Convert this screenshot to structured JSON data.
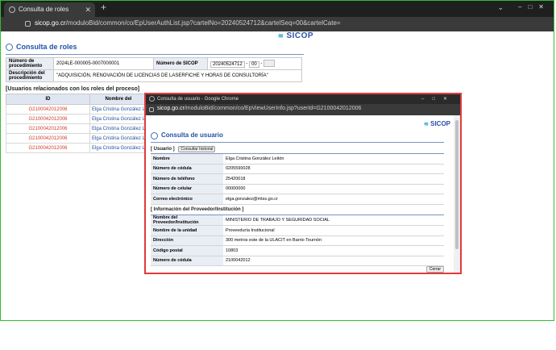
{
  "browser": {
    "tab_title": "Consulta de roles",
    "url_host": "sicop.go.cr",
    "url_path": "/moduloBid/common/co/EpUserAuthList.jsp?cartelNo=20240524712&cartelSeq=00&cartelCate="
  },
  "logo": "SICOP",
  "main": {
    "title": "Consulta de roles",
    "info": {
      "proc_label": "Número de procedimiento",
      "proc_value": "2024LE-000005-0007000001",
      "sicop_label": "Número de SICOP",
      "sicop_value": "20240524712",
      "sicop_seq": "00",
      "desc_label": "Descripción del procedimiento",
      "desc_value": "\"ADQUISICIÓN, RENOVACIÓN DE LICENCIAS DE LASERFICHE Y HORAS DE CONSULTORÍA\""
    },
    "rel_title": "[Usuarios relacionados con los roles del proceso]",
    "rel_headers": [
      "ID",
      "Nombre del"
    ],
    "rel_rows": [
      {
        "id": "G2100042012006",
        "name": "Elga Cristina González L"
      },
      {
        "id": "G2100042012006",
        "name": "Elga Cristina González L"
      },
      {
        "id": "G2100042012006",
        "name": "Elga Cristina González L"
      },
      {
        "id": "G2100042012006",
        "name": "Elga Cristina González L"
      },
      {
        "id": "G2100042012006",
        "name": "Elga Cristina González L"
      }
    ]
  },
  "popup": {
    "window_title": "Consulta de usuario - Google Chrome",
    "url_host": "sicop.go.cr",
    "url_path": "/moduloBid/common/co/EpViewUserInfo.jsp?userId=G2100042012006",
    "title": "Consulta de usuario",
    "user_section": "[ Usuario ]",
    "history_button": "Consultar historial",
    "user_rows": [
      {
        "label": "Nombre",
        "value": "Elga Cristina González Leitón"
      },
      {
        "label": "Número de cédula",
        "value": "0205590028"
      },
      {
        "label": "Número de teléfono",
        "value": "25420018"
      },
      {
        "label": "Número de celular",
        "value": "00000000"
      },
      {
        "label": "Correo electrónico",
        "value": "elga.gonzalez@mtss.go.cr"
      }
    ],
    "provider_section": "[ Información del Proveedor/Institución ]",
    "provider_rows": [
      {
        "label": "Nombre del Proveedor/Institución",
        "value": "MINISTERIO DE TRABAJO Y SEGURIDAD SOCIAL"
      },
      {
        "label": "Nombre de la unidad",
        "value": "Proveeduría Institucional"
      },
      {
        "label": "Dirección",
        "value": "300 metros este de la ULACIT en Barrio Tournón"
      },
      {
        "label": "Código postal",
        "value": "10803"
      },
      {
        "label": "Número de cédula",
        "value": "2100042012"
      }
    ],
    "close_button": "Cerrar"
  }
}
